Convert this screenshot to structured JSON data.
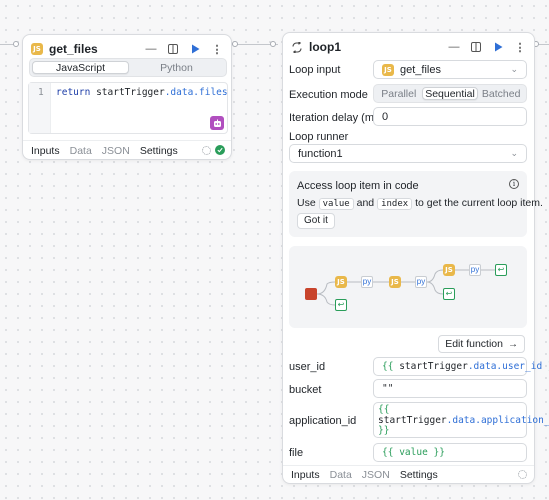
{
  "left_node": {
    "title": "get_files",
    "lang_tabs": [
      "JavaScript",
      "Python"
    ],
    "code_line_number": "1",
    "code_keyword": "return",
    "code_object": "startTrigger",
    "code_props": ".data.files",
    "bottom_tabs": [
      "Inputs",
      "Data",
      "JSON",
      "Settings"
    ]
  },
  "loop_node": {
    "title": "loop1",
    "loop_input_label": "Loop input",
    "loop_input_value": "get_files",
    "execution_mode_label": "Execution mode",
    "execution_modes": [
      "Parallel",
      "Sequential",
      "Batched"
    ],
    "iteration_delay_label": "Iteration delay (ms)",
    "iteration_delay_value": "0",
    "loop_runner_label": "Loop runner",
    "loop_runner_value": "function1",
    "info_title": "Access loop item in code",
    "info_use": "Use",
    "info_value_code": "value",
    "info_and": "and",
    "info_index_code": "index",
    "info_rest": "to get the current loop item.",
    "got_it": "Got it",
    "edit_function": "Edit function",
    "params": [
      {
        "label": "user_id",
        "open": "{{",
        "obj": "startTrigger",
        "prop": ".data.user_id",
        "close": "}}"
      },
      {
        "label": "bucket",
        "plain": "\"\""
      },
      {
        "label": "application_id",
        "open": "{{",
        "obj": "startTrigger",
        "prop": ".data.application_id",
        "close": "}}"
      },
      {
        "label": "file",
        "open": "{{",
        "obj": "value",
        "close": "}}"
      }
    ],
    "bottom_tabs": [
      "Inputs",
      "Data",
      "JSON",
      "Settings"
    ]
  },
  "colors": {
    "accent": "#2f6fd6",
    "js_badge": "#e9b84a",
    "success": "#2a9d5a",
    "ai_badge": "#b14fbf",
    "mini_start": "#c8442c"
  }
}
